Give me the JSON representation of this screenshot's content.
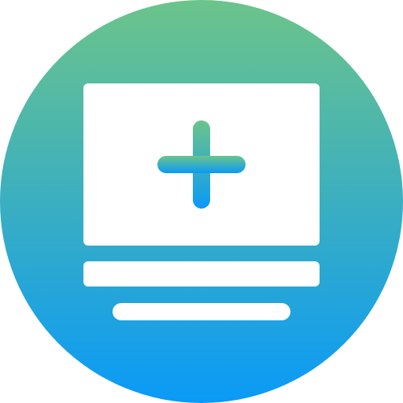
{
  "icon": {
    "name": "medical-monitor-add-icon",
    "gradient_top": "#6CC48A",
    "gradient_bottom": "#0A9AF7",
    "foreground": "#FFFFFF"
  }
}
